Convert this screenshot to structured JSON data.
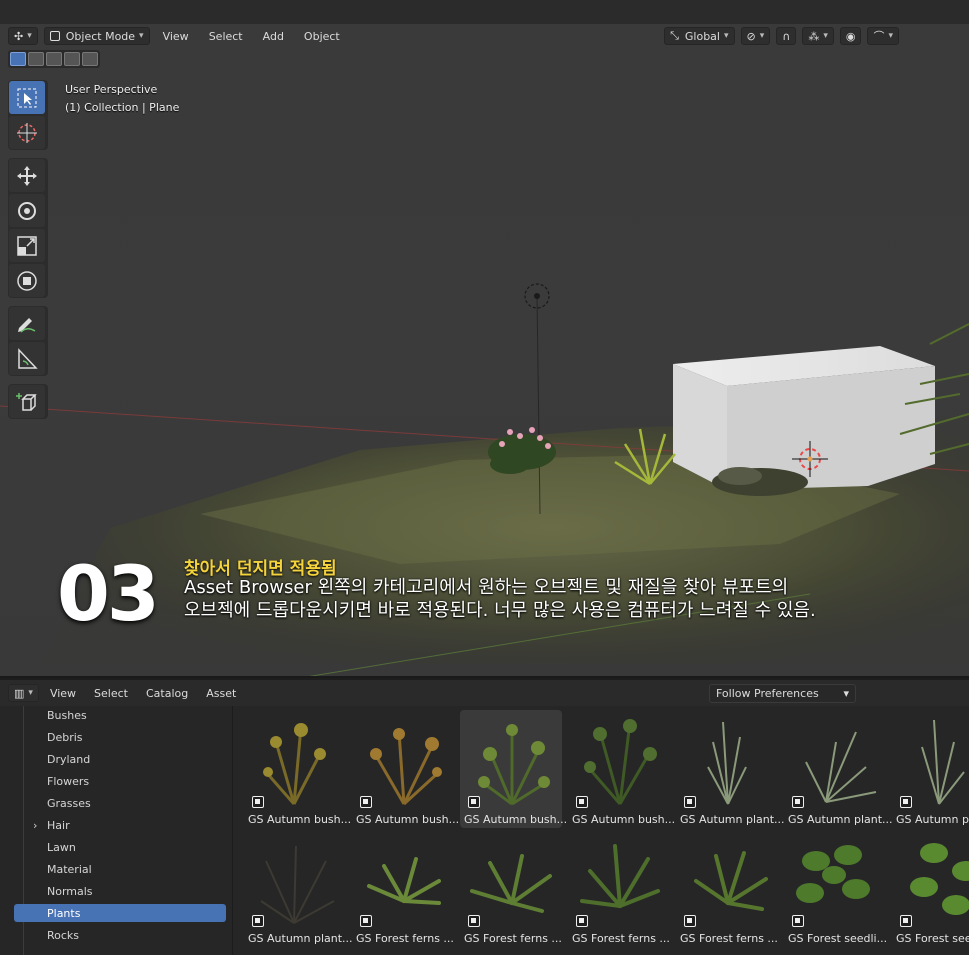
{
  "viewport": {
    "mode_label": "Object Mode",
    "menus": [
      "View",
      "Select",
      "Add",
      "Object"
    ],
    "orientation_label": "Global",
    "perspective_label": "User Perspective",
    "collection_label": "(1) Collection | Plane"
  },
  "caption": {
    "number": "03",
    "title": "찾아서 던지면 적용됨",
    "line1": "Asset Browser 왼쪽의 카테고리에서 원하는 오브젝트 및 재질을 찾아 뷰포트의",
    "line2": "오브젝에 드롭다운시키면 바로 적용된다. 너무 많은 사용은 컴퓨터가 느려질 수 있음."
  },
  "asset_browser": {
    "menus": [
      "View",
      "Select",
      "Catalog",
      "Asset"
    ],
    "library_label": "Follow Preferences",
    "catalogs": [
      {
        "label": "Bushes"
      },
      {
        "label": "Debris"
      },
      {
        "label": "Dryland"
      },
      {
        "label": "Flowers"
      },
      {
        "label": "Grasses"
      },
      {
        "label": "Hair"
      },
      {
        "label": "Lawn"
      },
      {
        "label": "Material"
      },
      {
        "label": "Normals"
      },
      {
        "label": "Plants"
      },
      {
        "label": "Rocks"
      }
    ],
    "selected_catalog": "Plants",
    "assets_row1": [
      "GS Autumn bush...",
      "GS Autumn bush...",
      "GS Autumn bush...",
      "GS Autumn bush...",
      "GS Autumn plant...",
      "GS Autumn plant...",
      "GS Autumn pla"
    ],
    "assets_row2": [
      "GS Autumn plant...",
      "GS Forest ferns ...",
      "GS Forest ferns ...",
      "GS Forest ferns ...",
      "GS Forest ferns ...",
      "GS Forest seedli...",
      "GS Forest see"
    ]
  },
  "colors": {
    "accent_blue": "#4772b3",
    "caption_yellow": "#f5d33b"
  }
}
